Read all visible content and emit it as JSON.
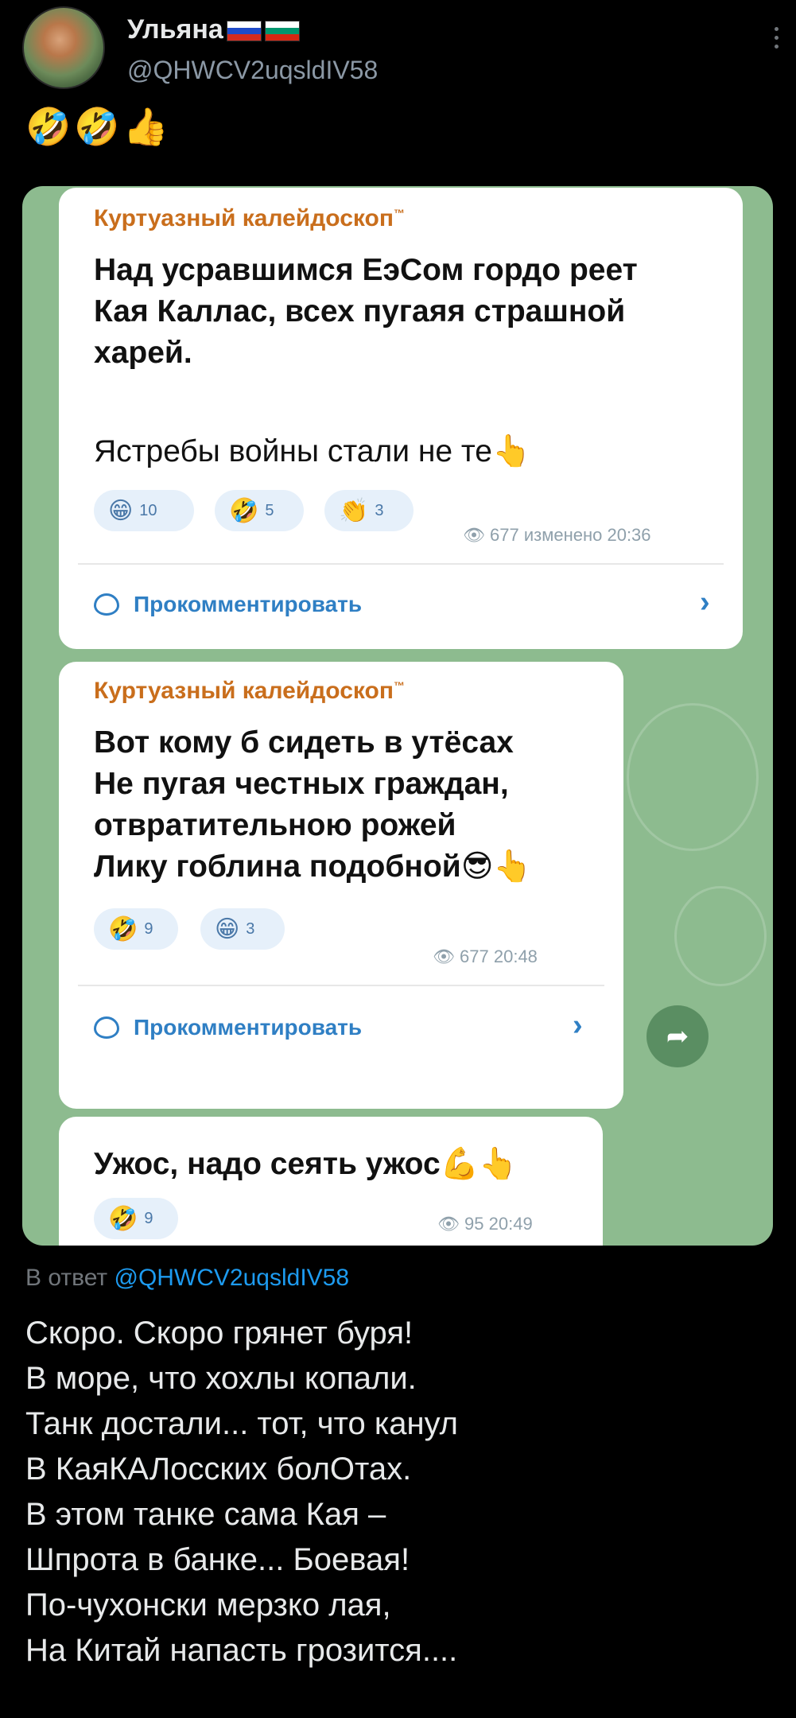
{
  "header": {
    "name": "Ульяна",
    "handle": "@QHWCV2uqsldIV58",
    "flag_colors": [
      "#ffffff",
      "#1f4bc9",
      "#d52b1e"
    ],
    "flag2_colors": [
      "#ffffff",
      "#00966e",
      "#d62612"
    ]
  },
  "post_emojis": "🤣🤣👍",
  "media": {
    "bubble1": {
      "channel": "Куртуазный калейдоскоп",
      "tm": "™",
      "text_lines": [
        "Над усравшимся ЕэСом гордо реет",
        "Кая Каллас, всех пугаяя страшной",
        "харей."
      ],
      "text2": "Ястребы войны стали не те👆",
      "reactions": [
        {
          "emoji": "😁",
          "count": "10"
        },
        {
          "emoji": "🤣",
          "count": "5"
        },
        {
          "emoji": "👏",
          "count": "3"
        }
      ],
      "meta": "👁 677 изменено 20:36",
      "comment_label": "Прокомментировать"
    },
    "bubble2": {
      "channel": "Куртуазный калейдоскоп",
      "tm": "™",
      "text_lines": [
        "Вот кому б сидеть в утёсах",
        "Не пугая честных граждан,",
        "отвратительною рожей",
        "Лику гоблина подобной😎👆"
      ],
      "reactions": [
        {
          "emoji": "🤣",
          "count": "9"
        },
        {
          "emoji": "😁",
          "count": "3"
        }
      ],
      "meta": "👁 677  20:48",
      "comment_label": "Прокомментировать"
    },
    "bubble3": {
      "text": "Ужос, надо сеять ужос💪👆",
      "reactions": [
        {
          "emoji": "🤣",
          "count": "9"
        }
      ],
      "meta": "👁 95  20:49"
    }
  },
  "reply": {
    "prefix": "В ответ",
    "handle": "@QHWCV2uqsldIV58"
  },
  "poem_lines": [
    "Скоро. Скоро грянет буря!",
    "В море, что хохлы копали.",
    "Танк достали...  тот, что канул",
    "В КаяКАЛосских болОтах.",
    "В этом танке сама Кая –",
    "Шпрота в банке... Боевая!",
    "По-чухонски мерзко лая,",
    "На Китай напасть грозится...."
  ]
}
